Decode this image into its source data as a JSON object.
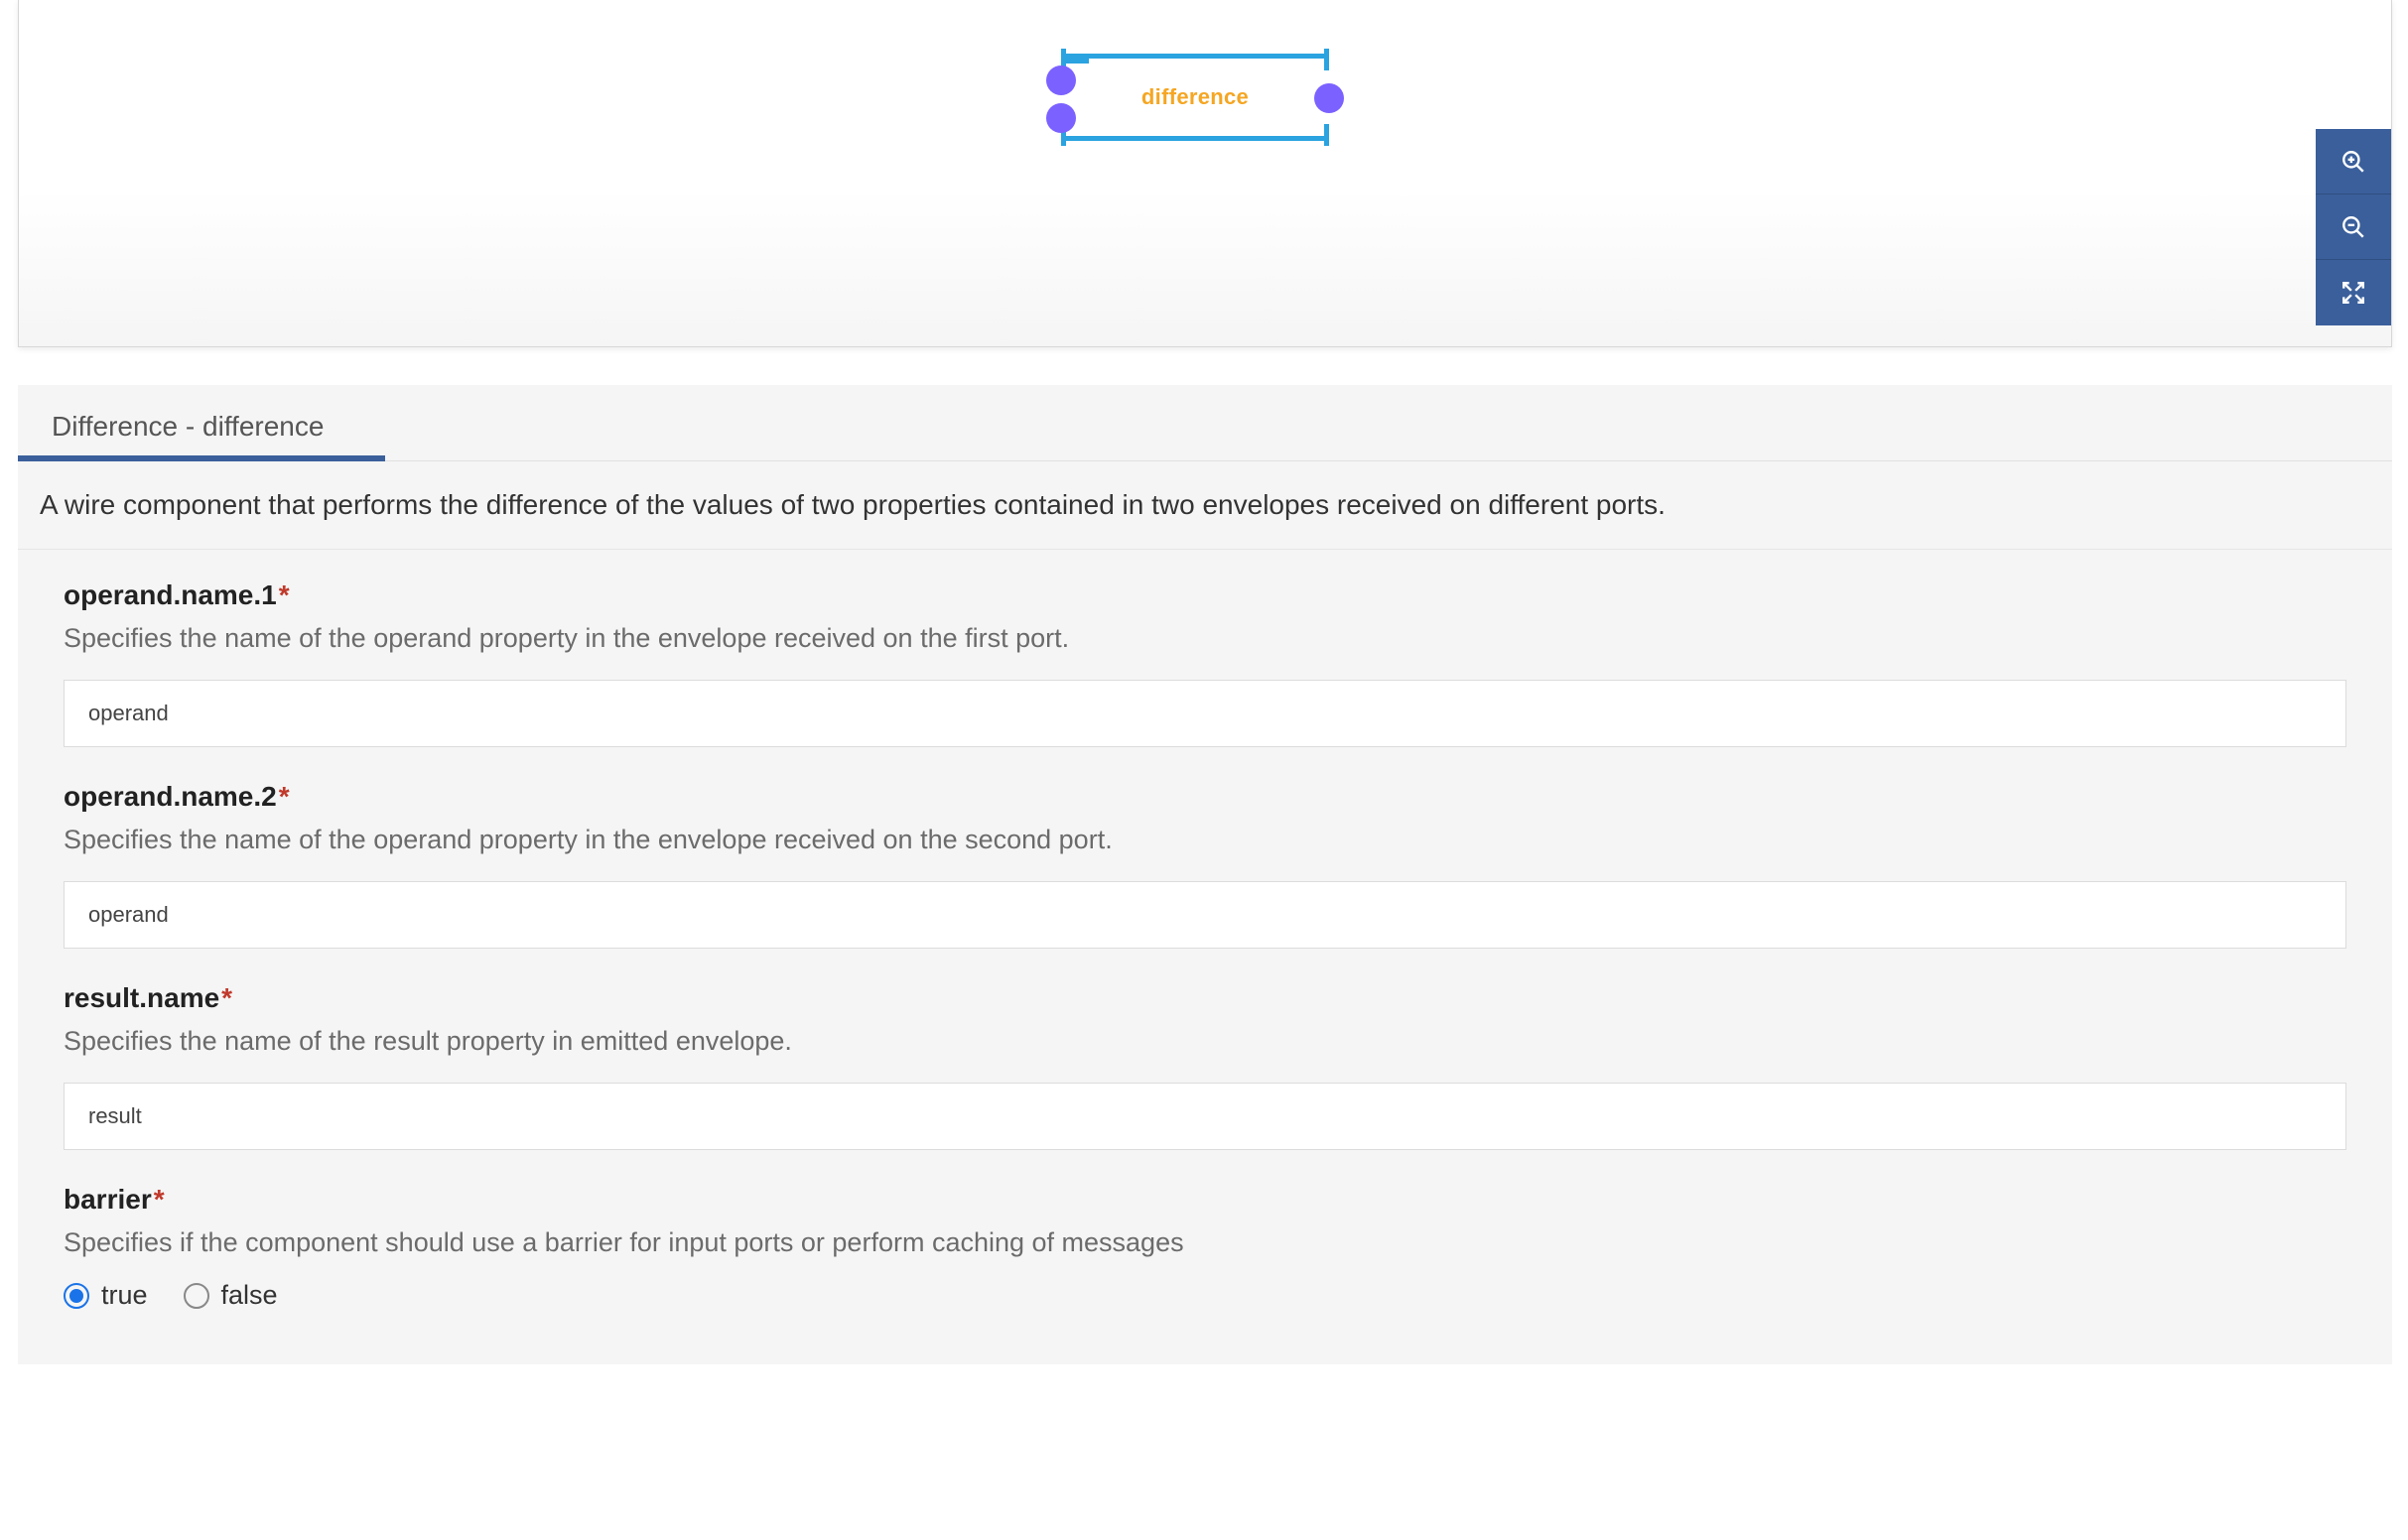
{
  "node": {
    "label": "difference"
  },
  "panel": {
    "title": "Difference - difference",
    "description": "A wire component that performs the difference of the values of two properties contained in two envelopes received on different ports."
  },
  "fields": {
    "operand1": {
      "label": "operand.name.1",
      "help": "Specifies the name of the operand property in the envelope received on the first port.",
      "value": "operand"
    },
    "operand2": {
      "label": "operand.name.2",
      "help": "Specifies the name of the operand property in the envelope received on the second port.",
      "value": "operand"
    },
    "result": {
      "label": "result.name",
      "help": "Specifies the name of the result property in emitted envelope.",
      "value": "result"
    },
    "barrier": {
      "label": "barrier",
      "help": "Specifies if the component should use a barrier for input ports or perform caching of messages",
      "true_label": "true",
      "false_label": "false",
      "value": "true"
    }
  },
  "required_mark": "*"
}
